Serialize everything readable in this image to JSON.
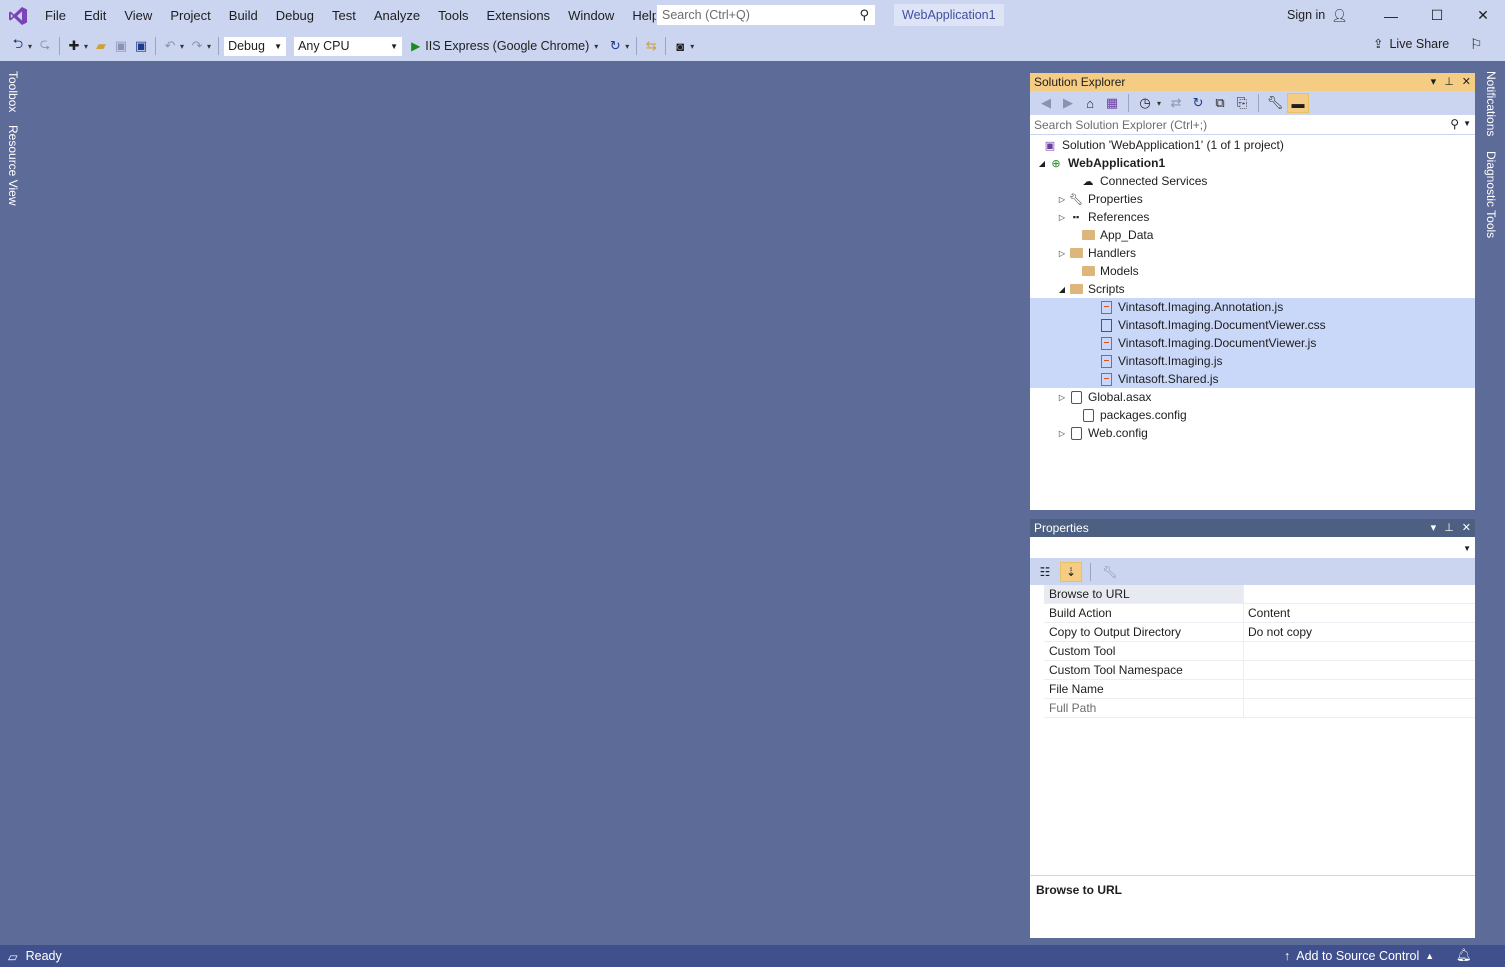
{
  "menu": {
    "items": [
      "File",
      "Edit",
      "View",
      "Project",
      "Build",
      "Debug",
      "Test",
      "Analyze",
      "Tools",
      "Extensions",
      "Window",
      "Help"
    ],
    "search_placeholder": "Search (Ctrl+Q)",
    "solution_name": "WebApplication1",
    "sign_in": "Sign in"
  },
  "toolbar": {
    "configuration": "Debug",
    "platform": "Any CPU",
    "run_target": "IIS Express (Google Chrome)",
    "live_share": "Live Share"
  },
  "side_tabs": {
    "left": [
      "Toolbox",
      "Resource View"
    ],
    "right": [
      "Notifications",
      "Diagnostic Tools"
    ]
  },
  "solution_explorer": {
    "title": "Solution Explorer",
    "search_placeholder": "Search Solution Explorer (Ctrl+;)",
    "tree": [
      {
        "label": "Solution 'WebApplication1' (1 of 1 project)",
        "icon": "solution-icon",
        "expander": ""
      },
      {
        "label": "WebApplication1",
        "icon": "web-project-icon",
        "expander": "◢"
      },
      {
        "label": "Connected Services",
        "icon": "connected-services-icon",
        "expander": ""
      },
      {
        "label": "Properties",
        "icon": "wrench-icon",
        "expander": "▷"
      },
      {
        "label": "References",
        "icon": "references-icon",
        "expander": "▷"
      },
      {
        "label": "App_Data",
        "icon": "folder-icon",
        "expander": ""
      },
      {
        "label": "Handlers",
        "icon": "folder-icon",
        "expander": "▷"
      },
      {
        "label": "Models",
        "icon": "folder-icon",
        "expander": ""
      },
      {
        "label": "Scripts",
        "icon": "folder-open-icon",
        "expander": "◢"
      },
      {
        "label": "Vintasoft.Imaging.Annotation.js",
        "icon": "js-file-icon",
        "expander": ""
      },
      {
        "label": "Vintasoft.Imaging.DocumentViewer.css",
        "icon": "css-file-icon",
        "expander": ""
      },
      {
        "label": "Vintasoft.Imaging.DocumentViewer.js",
        "icon": "js-file-icon",
        "expander": ""
      },
      {
        "label": "Vintasoft.Imaging.js",
        "icon": "js-file-icon",
        "expander": ""
      },
      {
        "label": "Vintasoft.Shared.js",
        "icon": "js-file-icon",
        "expander": ""
      },
      {
        "label": "Global.asax",
        "icon": "asax-file-icon",
        "expander": "▷"
      },
      {
        "label": "packages.config",
        "icon": "config-file-icon",
        "expander": ""
      },
      {
        "label": "Web.config",
        "icon": "config-file-icon",
        "expander": "▷"
      }
    ]
  },
  "properties": {
    "title": "Properties",
    "rows": [
      {
        "name": "Browse to URL",
        "value": ""
      },
      {
        "name": "Build Action",
        "value": "Content"
      },
      {
        "name": "Copy to Output Directory",
        "value": "Do not copy"
      },
      {
        "name": "Custom Tool",
        "value": ""
      },
      {
        "name": "Custom Tool Namespace",
        "value": ""
      },
      {
        "name": "File Name",
        "value": ""
      },
      {
        "name": "Full Path",
        "value": ""
      }
    ],
    "description": "Browse to URL"
  },
  "status": {
    "text": "Ready",
    "source_control": "Add to Source Control"
  },
  "colors": {
    "accent": "#f5cc84",
    "chrome": "#ccd5f0",
    "background": "#5d6b99",
    "statusbar": "#40508d"
  }
}
